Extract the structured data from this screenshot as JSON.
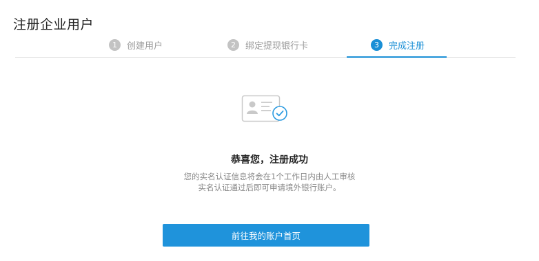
{
  "page": {
    "title": "注册企业用户"
  },
  "steps": [
    {
      "number": "1",
      "label": "创建用户",
      "state": "done"
    },
    {
      "number": "2",
      "label": "绑定提现银行卡",
      "state": "done"
    },
    {
      "number": "3",
      "label": "完成注册",
      "state": "active"
    }
  ],
  "result": {
    "icon": "id-card-verified-icon",
    "title": "恭喜您，注册成功",
    "desc_line1": "您的实名认证信息将会在1个工作日内由人工审核",
    "desc_line2": "实名认证通过后即可申请境外银行账户。"
  },
  "actions": {
    "primary_label": "前往我的账户首页"
  },
  "colors": {
    "accent": "#1a8fd6",
    "step_inactive": "#c3c3c3",
    "button": "#1f93db"
  }
}
